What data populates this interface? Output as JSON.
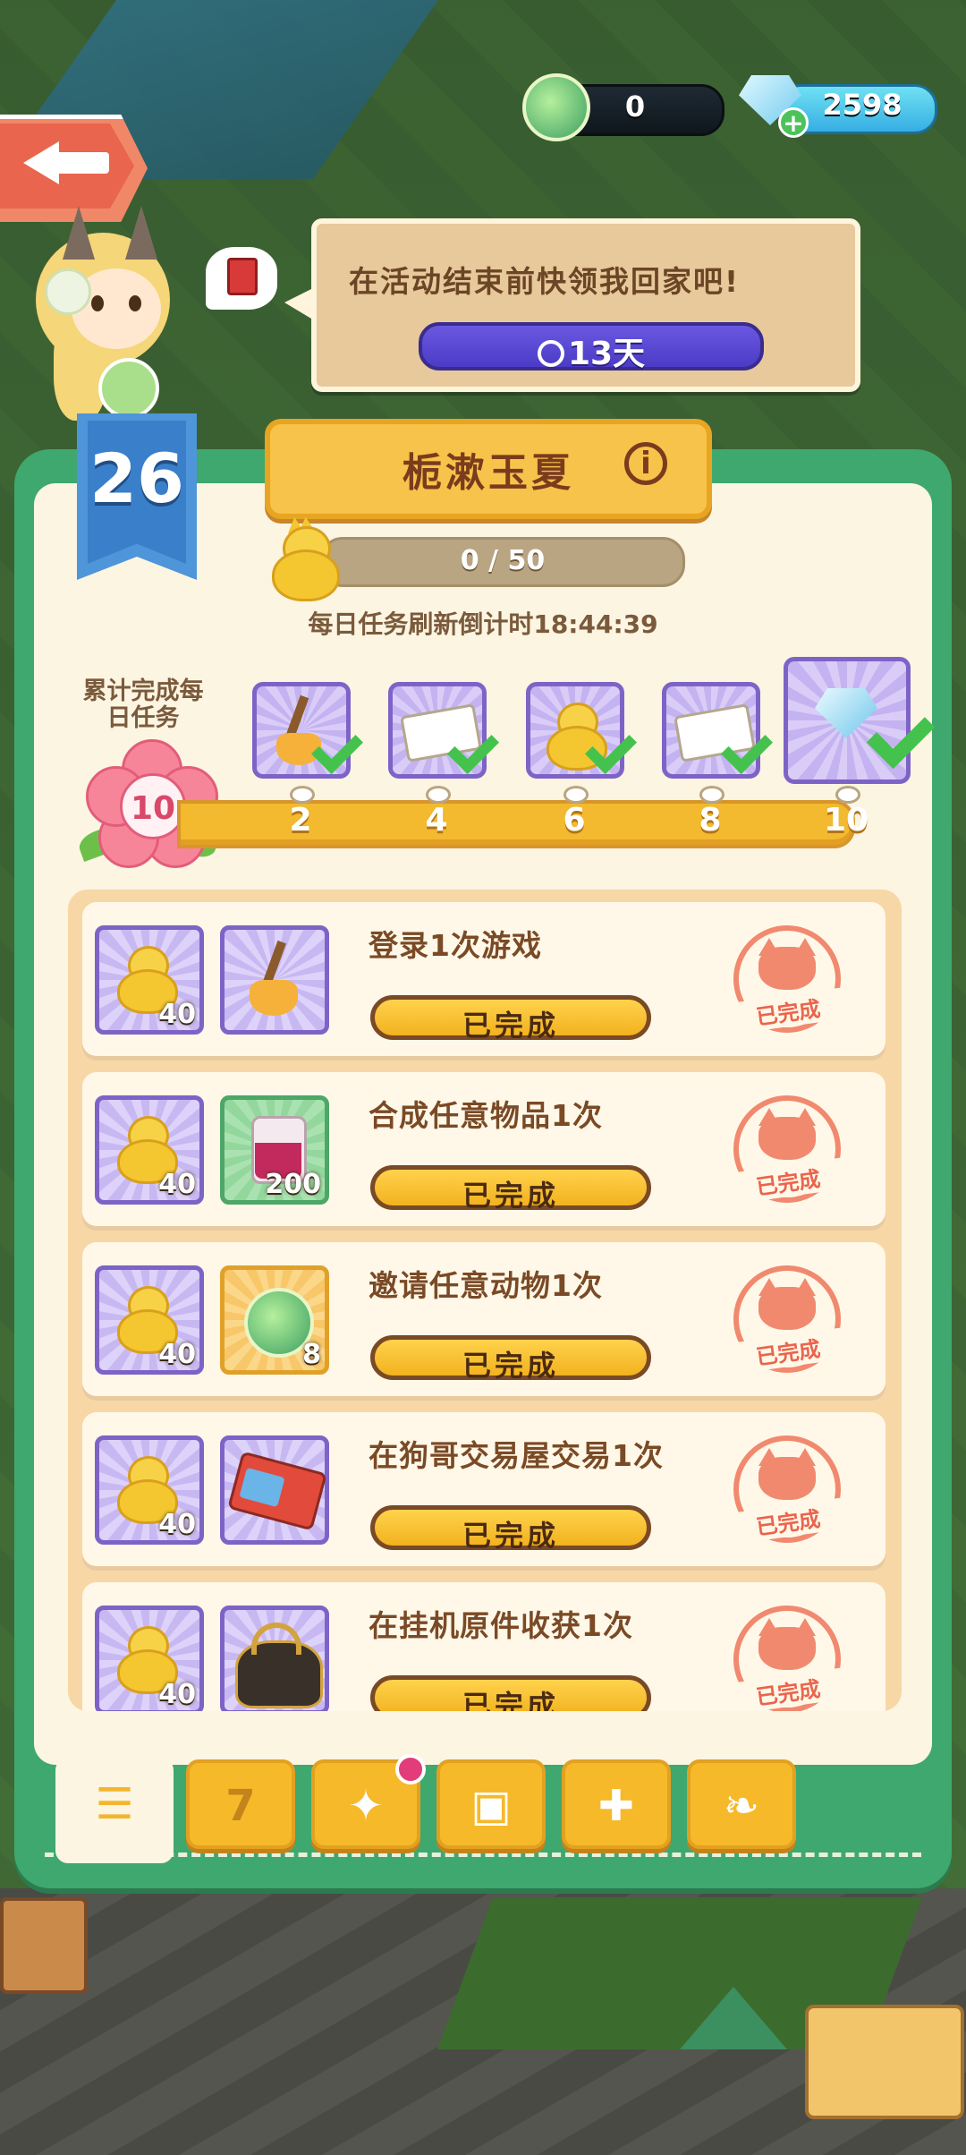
{
  "currency": {
    "leaf_count": "0",
    "gem_count": "2598"
  },
  "bubble": {
    "message": "在活动结束前快领我回家吧!",
    "timer": "13天"
  },
  "panel": {
    "title": "栀漱玉夏",
    "level": "26",
    "progress_text": "0 / 50",
    "progress_fraction": 0,
    "refresh_text": "每日任务刷新倒计时18:44:39"
  },
  "milestones": {
    "label": "累计完成每日任务",
    "current": "10",
    "steps": [
      "2",
      "4",
      "6",
      "8",
      "10"
    ],
    "rewards": [
      "broom-icon",
      "ticket-icon",
      "duck-icon",
      "ticket-icon",
      "gem-icon"
    ]
  },
  "tasks": [
    {
      "title": "登录1次游戏",
      "reward_count": "40",
      "item_icon": "broom-icon",
      "item_count": "",
      "button": "已完成",
      "stamp": "已完成"
    },
    {
      "title": "合成任意物品1次",
      "reward_count": "40",
      "item_icon": "jam-jar-icon",
      "item_count": "200",
      "button": "已完成",
      "stamp": "已完成"
    },
    {
      "title": "邀请任意动物1次",
      "reward_count": "40",
      "item_icon": "leaf-orb-icon",
      "item_count": "8",
      "button": "已完成",
      "stamp": "已完成"
    },
    {
      "title": "在狗哥交易屋交易1次",
      "reward_count": "40",
      "item_icon": "ticket-bundle-icon",
      "item_count": "",
      "button": "已完成",
      "stamp": "已完成"
    },
    {
      "title": "在挂机原件收获1次",
      "reward_count": "40",
      "item_icon": "bag-icon",
      "item_count": "",
      "button": "已完成",
      "stamp": "已完成"
    }
  ],
  "tabs": [
    {
      "name": "list-icon",
      "glyph": "☰"
    },
    {
      "name": "calendar-icon",
      "glyph": "7"
    },
    {
      "name": "horn-icon",
      "glyph": "✦"
    },
    {
      "name": "cards-icon",
      "glyph": "▣"
    },
    {
      "name": "gift-icon",
      "glyph": "✚"
    },
    {
      "name": "leaf-icon",
      "glyph": "❧"
    }
  ],
  "colors": {
    "panel_green": "#3fa86e",
    "cream": "#fbf5e2",
    "accent_yellow": "#f6b92a",
    "purple_slot": "#7e63c7",
    "stamp_red": "#f07d63"
  }
}
